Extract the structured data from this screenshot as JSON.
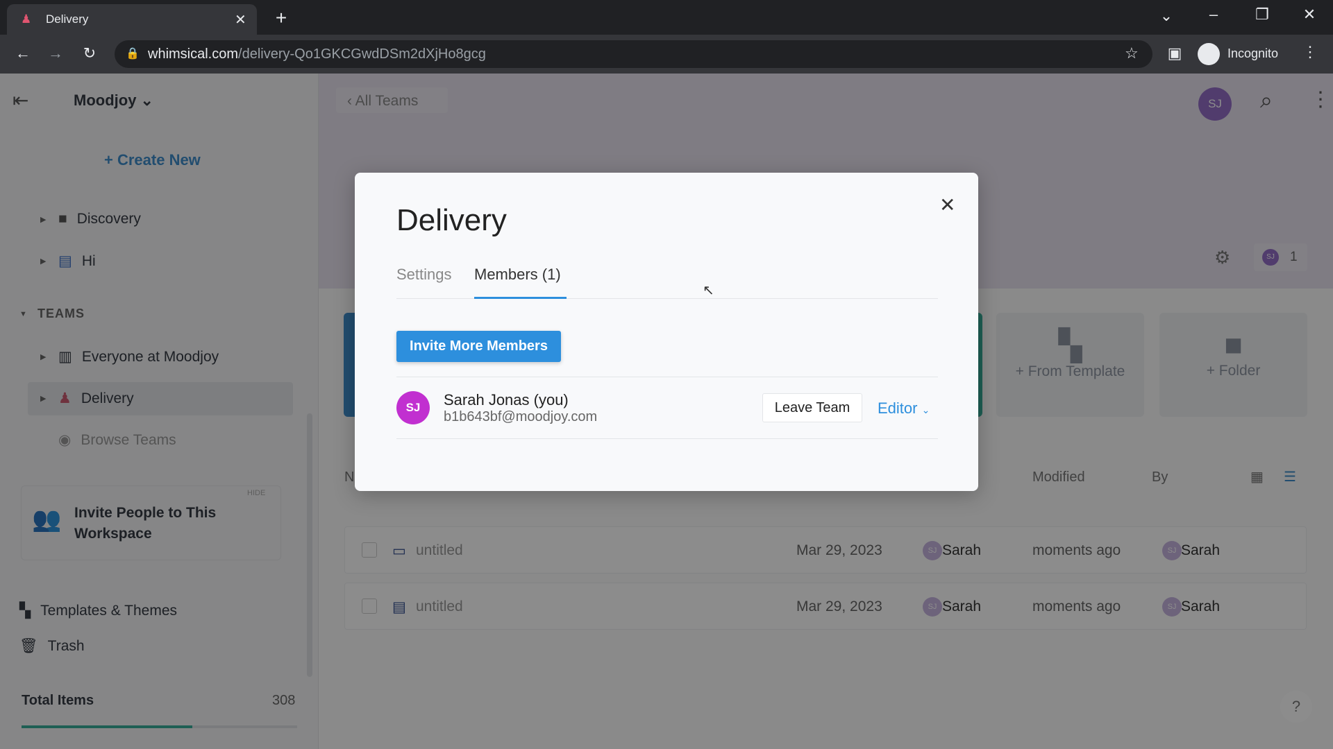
{
  "browser": {
    "tab_title": "Delivery",
    "url_domain": "whimsical.com",
    "url_path": "/delivery-Qo1GKCGwdDSm2dXjHo8gcg",
    "profile": "Incognito"
  },
  "sidebar": {
    "workspace": "Moodjoy",
    "create_new": "Create New",
    "items": [
      {
        "label": "Discovery",
        "icon": "folder-icon"
      },
      {
        "label": "Hi",
        "icon": "doc-icon"
      }
    ],
    "teams_header": "TEAMS",
    "teams": [
      {
        "label": "Everyone at Moodjoy"
      },
      {
        "label": "Delivery",
        "selected": true
      },
      {
        "label": "Browse Teams"
      }
    ],
    "invite": {
      "label": "Invite People to This Workspace",
      "hide": "HIDE"
    },
    "templates": "Templates & Themes",
    "trash": "Trash",
    "total_label": "Total Items",
    "total_value": "308",
    "usage_fraction": 0.62
  },
  "main": {
    "back": "All Teams",
    "avatar": "SJ",
    "member_chip": {
      "initials": "SJ",
      "count": "1"
    },
    "cards": {
      "template": "+ From Template",
      "folder": "+ Folder"
    },
    "columns": {
      "name": "N",
      "modified": "Modified",
      "by": "By"
    },
    "rows": [
      {
        "name": "untitled",
        "icon": "presentation-icon",
        "created": "Mar 29, 2023",
        "creator": "Sarah",
        "modified": "moments ago",
        "by": "Sarah"
      },
      {
        "name": "untitled",
        "icon": "board-icon",
        "created": "Mar 29, 2023",
        "creator": "Sarah",
        "modified": "moments ago",
        "by": "Sarah"
      }
    ],
    "help": "?"
  },
  "modal": {
    "title": "Delivery",
    "tabs": [
      "Settings",
      "Members (1)"
    ],
    "active_tab": 1,
    "invite_button": "Invite More Members",
    "member": {
      "initials": "SJ",
      "name": "Sarah Jonas (you)",
      "email": "b1b643bf@moodjoy.com",
      "leave": "Leave Team",
      "role": "Editor"
    }
  },
  "colors": {
    "accent": "#2d8fdd",
    "avatar": "#c130d0"
  }
}
